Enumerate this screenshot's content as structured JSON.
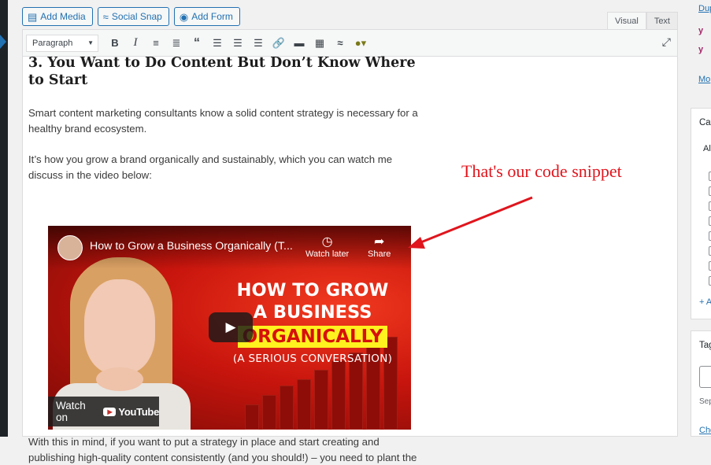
{
  "media_buttons": [
    {
      "label": "Add Media",
      "icon": "add-media-icon"
    },
    {
      "label": "Social Snap",
      "icon": "social-snap-icon"
    },
    {
      "label": "Add Form",
      "icon": "add-form-icon"
    }
  ],
  "editor_tabs": {
    "visual": "Visual",
    "text": "Text",
    "active": "Visual"
  },
  "toolbar": {
    "format_select": "Paragraph",
    "buttons": [
      "bold-icon",
      "italic-icon",
      "bulleted-list-icon",
      "numbered-list-icon",
      "blockquote-icon",
      "align-left-icon",
      "align-center-icon",
      "align-right-icon",
      "link-icon",
      "read-more-icon",
      "toolbar-toggle-icon",
      "social-snap-icon",
      "plugin-icon"
    ],
    "bold": "B",
    "italic": "I"
  },
  "content": {
    "heading": "3. You Want to Do Content But Don’t Know Where to Start",
    "paragraph1": "Smart content marketing consultants know a solid content strategy is necessary for a healthy brand ecosystem.",
    "paragraph2": "It’s how you grow a brand organically and sustainably, which you can watch me discuss in the video below:",
    "paragraph3": "With this in mind, if you want to put a strategy in place and start creating and publishing high-quality content consistently (and you should!) – you need to plant the"
  },
  "video": {
    "title": "How to Grow a Business Organically (T...",
    "watch_later": "Watch later",
    "share": "Share",
    "thumb_line1": "HOW TO GROW",
    "thumb_line2": "A BUSINESS",
    "thumb_line3": "ORGANICALLY",
    "thumb_line4": "(A SERIOUS CONVERSATION)",
    "watch_on": "Watch on",
    "youtube": "YouTube"
  },
  "annotation": {
    "text": "That's our code snippet",
    "color": "#e0151d"
  },
  "right_panel": {
    "dup": "Dup",
    "more": "Mo",
    "categories_head": "Cat",
    "all": "Al",
    "add": "+ A",
    "tags_head": "Tag",
    "sep": "Sep",
    "cho": "Cho"
  },
  "colors": {
    "accent": "#2271b1",
    "editor_bg": "#ffffff",
    "video_red": "#c8150d",
    "yellow": "#fff21f"
  }
}
